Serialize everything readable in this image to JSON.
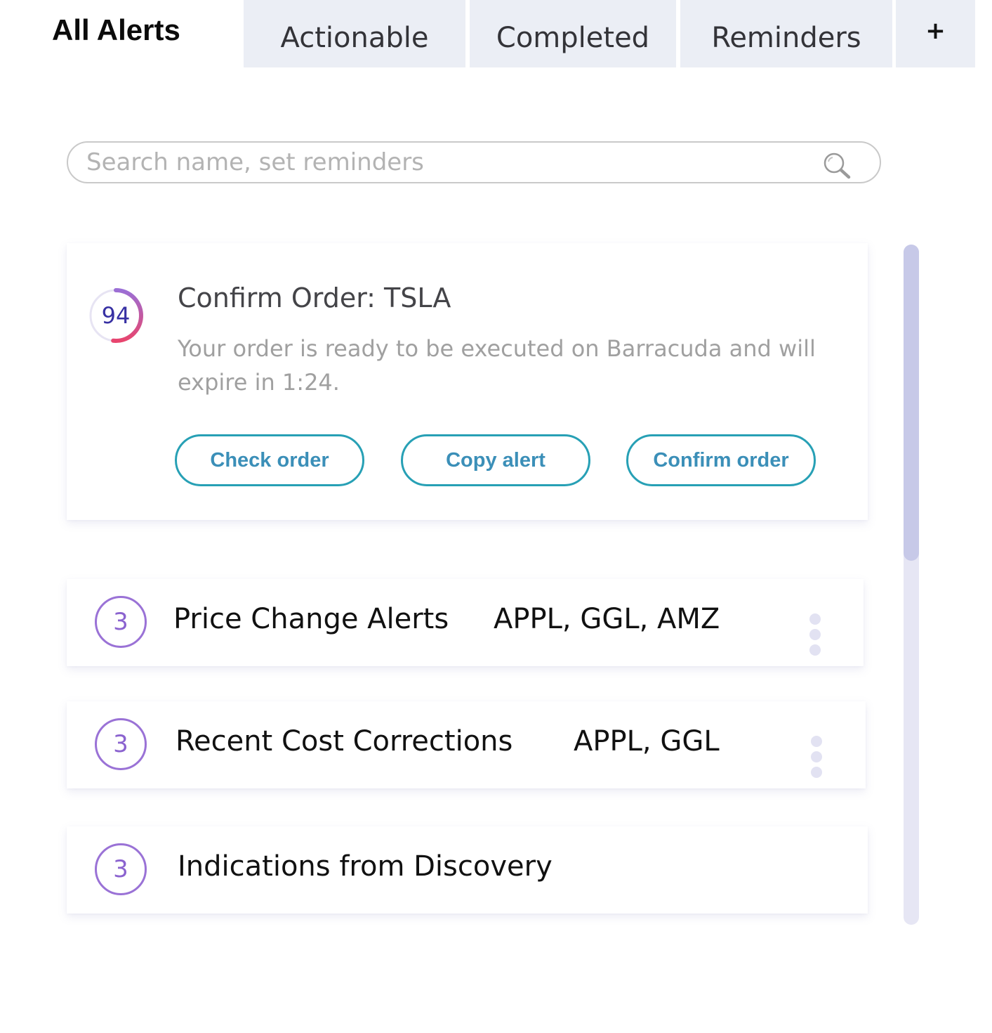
{
  "tabs": {
    "all_alerts": "All Alerts",
    "actionable": "Actionable",
    "completed": "Completed",
    "reminders": "Reminders",
    "add": "+"
  },
  "search": {
    "placeholder": "Search name, set reminders",
    "value": ""
  },
  "alert_card": {
    "score": "94",
    "score_fraction": 0.94,
    "title": "Confirm Order: TSLA",
    "description": "Your order is ready to be executed on Barracuda and will expire in 1:24.",
    "buttons": {
      "check_order": "Check order",
      "copy_alert": "Copy alert",
      "confirm_order": "Confirm order"
    }
  },
  "groups": [
    {
      "count": "3",
      "label": "Price Change Alerts",
      "tickers": "APPL, GGL, AMZ"
    },
    {
      "count": "3",
      "label": "Recent Cost Corrections",
      "tickers": "APPL, GGL"
    },
    {
      "count": "3",
      "label": "Indications from Discovery",
      "tickers": ""
    }
  ],
  "colors": {
    "tab_background": "#ebeef5",
    "button_border": "#27a0b5",
    "button_text": "#3b8fb8",
    "badge_purple": "#9a72d6",
    "score_gradient_start": "#9b6fd6",
    "score_gradient_end": "#e8456e",
    "scroll_thumb": "#c7c9e8",
    "scroll_track": "#e6e6f4"
  }
}
